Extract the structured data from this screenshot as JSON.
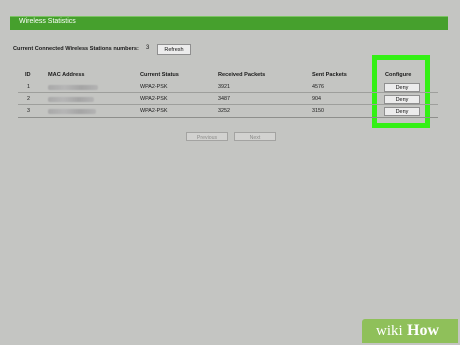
{
  "header": {
    "title": "Wireless Statistics"
  },
  "stations": {
    "label": "Current Connected Wireless Stations numbers:",
    "count": "3",
    "refresh_label": "Refresh"
  },
  "table": {
    "columns": [
      "ID",
      "MAC Address",
      "Current Status",
      "Received Packets",
      "Sent Packets",
      "Configure"
    ],
    "rows": [
      {
        "id": "1",
        "status": "WPA2-PSK",
        "received": "3921",
        "sent": "4576",
        "action": "Deny"
      },
      {
        "id": "2",
        "status": "WPA2-PSK",
        "received": "3487",
        "sent": "904",
        "action": "Deny"
      },
      {
        "id": "3",
        "status": "WPA2-PSK",
        "received": "3252",
        "sent": "3150",
        "action": "Deny"
      }
    ]
  },
  "pagination": {
    "previous_label": "Previous",
    "next_label": "Next"
  },
  "watermark": {
    "wiki": "wiki",
    "how": "How"
  },
  "colors": {
    "header_bar": "#46a02d",
    "highlight": "#33f015",
    "background": "#c4c5c2"
  }
}
